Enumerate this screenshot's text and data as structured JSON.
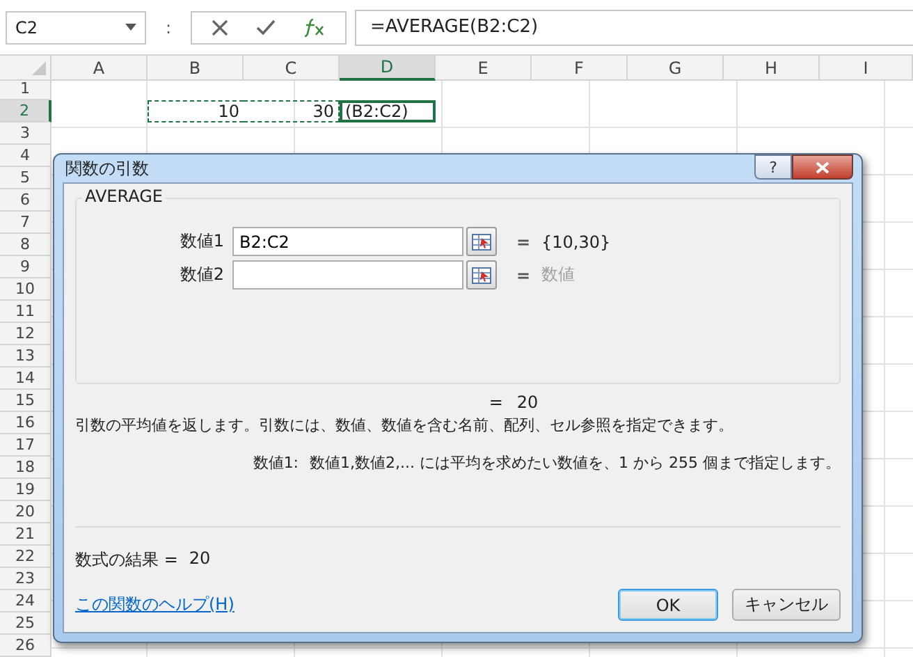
{
  "formula_bar": {
    "name_box": "C2",
    "separator": ":",
    "formula": "=AVERAGE(B2:C2)"
  },
  "sheet": {
    "columns": [
      {
        "label": "A",
        "selected": false
      },
      {
        "label": "B",
        "selected": false
      },
      {
        "label": "C",
        "selected": false
      },
      {
        "label": "D",
        "selected": true
      },
      {
        "label": "E",
        "selected": false
      },
      {
        "label": "F",
        "selected": false
      },
      {
        "label": "G",
        "selected": false
      },
      {
        "label": "H",
        "selected": false
      },
      {
        "label": "I",
        "selected": false
      }
    ],
    "rows": [
      {
        "label": "1",
        "selected": false,
        "cells": []
      },
      {
        "label": "2",
        "selected": true,
        "cells": [
          "",
          "10",
          "30",
          "(B2:C2)"
        ]
      },
      {
        "label": "3",
        "selected": false,
        "cells": []
      },
      {
        "label": "4",
        "selected": false,
        "cells": []
      },
      {
        "label": "5",
        "selected": false,
        "cells": []
      },
      {
        "label": "6",
        "selected": false,
        "cells": []
      },
      {
        "label": "7",
        "selected": false,
        "cells": []
      },
      {
        "label": "8",
        "selected": false,
        "cells": []
      },
      {
        "label": "9",
        "selected": false,
        "cells": []
      },
      {
        "label": "10",
        "selected": false,
        "cells": []
      },
      {
        "label": "11",
        "selected": false,
        "cells": []
      },
      {
        "label": "12",
        "selected": false,
        "cells": []
      },
      {
        "label": "13",
        "selected": false,
        "cells": []
      },
      {
        "label": "14",
        "selected": false,
        "cells": []
      },
      {
        "label": "15",
        "selected": false,
        "cells": []
      },
      {
        "label": "16",
        "selected": false,
        "cells": []
      },
      {
        "label": "17",
        "selected": false,
        "cells": []
      },
      {
        "label": "18",
        "selected": false,
        "cells": []
      },
      {
        "label": "19",
        "selected": false,
        "cells": []
      },
      {
        "label": "20",
        "selected": false,
        "cells": []
      },
      {
        "label": "21",
        "selected": false,
        "cells": []
      },
      {
        "label": "22",
        "selected": false,
        "cells": []
      },
      {
        "label": "23",
        "selected": false,
        "cells": []
      },
      {
        "label": "24",
        "selected": false,
        "cells": []
      },
      {
        "label": "25",
        "selected": false,
        "cells": []
      },
      {
        "label": "26",
        "selected": false,
        "cells": []
      }
    ]
  },
  "dialog": {
    "title": "関数の引数",
    "help_button": "?",
    "function_name": "AVERAGE",
    "arguments": [
      {
        "label": "数値1",
        "value": "B2:C2",
        "equals": "=",
        "result": "{10,30}",
        "dimmed": false
      },
      {
        "label": "数値2",
        "equals": "=",
        "result": "数値",
        "dimmed": true
      }
    ],
    "total_equals": "=",
    "total": "20",
    "description": "引数の平均値を返します。引数には、数値、数値を含む名前、配列、セル参照を指定できます。",
    "argument_help_label": "数値1:",
    "argument_help": "数値1,数値2,... には平均を求めたい数値を、1 から 255 個まで指定します。",
    "result_label": "数式の結果 =",
    "result": "20",
    "help_link": "この関数のヘルプ(H)",
    "buttons": [
      {
        "label": "OK",
        "default": true
      },
      {
        "label": "キャンセル",
        "default": false
      }
    ]
  }
}
